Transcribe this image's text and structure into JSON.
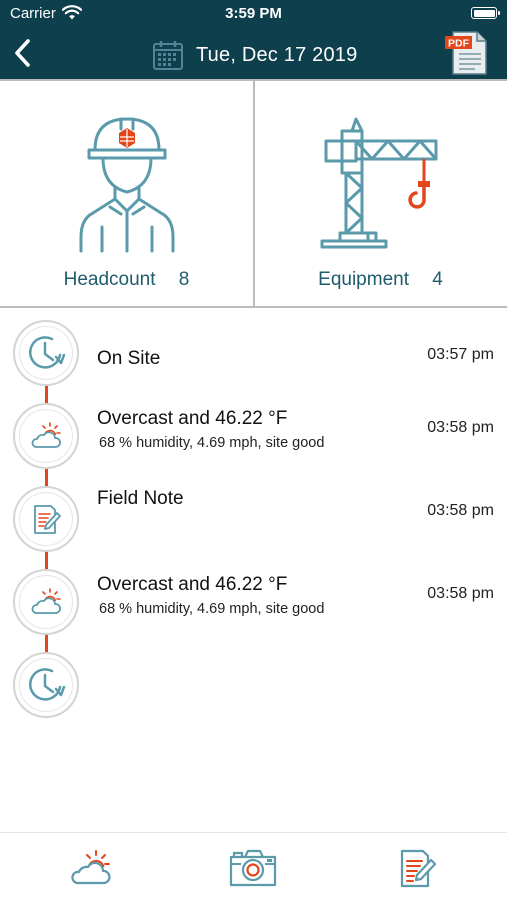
{
  "status_bar": {
    "carrier": "Carrier",
    "time": "3:59 PM"
  },
  "header": {
    "date": "Tue, Dec 17 2019",
    "pdf_icon_text": "PDF"
  },
  "tiles": [
    {
      "label": "Headcount",
      "count": "8",
      "icon": "worker-icon"
    },
    {
      "label": "Equipment",
      "count": "4",
      "icon": "crane-icon"
    }
  ],
  "timeline": [
    {
      "type": "clock-icon",
      "title": "On Site",
      "subtitle": "",
      "time": "03:57 pm"
    },
    {
      "type": "weather-icon",
      "title": "Overcast and 46.22 °F",
      "subtitle": "68 % humidity, 4.69 mph, site good",
      "time": "03:58 pm"
    },
    {
      "type": "note-icon",
      "title": "Field Note",
      "subtitle": "",
      "time": "03:58 pm"
    },
    {
      "type": "weather-icon",
      "title": "Overcast and 46.22 °F",
      "subtitle": "68 % humidity, 4.69 mph, site good",
      "time": "03:58 pm"
    },
    {
      "type": "clock-icon",
      "title": "",
      "subtitle": "",
      "time": ""
    }
  ],
  "bottom_bar": [
    "weather-icon",
    "camera-icon",
    "note-icon"
  ],
  "colors": {
    "header_bg": "#0d3f4d",
    "teal": "#1f5c6b",
    "icon_teal": "#5a9aab",
    "accent": "#e2461b"
  }
}
